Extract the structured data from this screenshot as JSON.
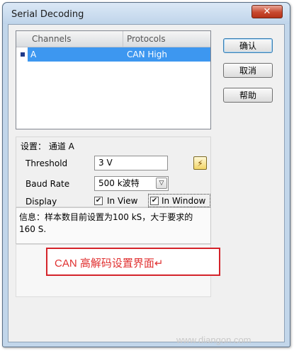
{
  "window": {
    "title": "Serial Decoding",
    "close_symbol": "✕"
  },
  "table": {
    "columns": [
      "Channels",
      "Protocols"
    ],
    "rows": [
      {
        "channel": "A",
        "protocol": "CAN High"
      }
    ]
  },
  "buttons": {
    "ok": "确认",
    "cancel": "取消",
    "help": "帮助"
  },
  "settings": {
    "heading": "设置： 通道 A",
    "threshold_label": "Threshold",
    "threshold_value": "3 V",
    "baud_label": "Baud Rate",
    "baud_value": "500 k波特",
    "display_label": "Display",
    "in_view_label": "In View",
    "in_view_checked": true,
    "in_window_label": "In Window",
    "in_window_checked": true
  },
  "info": {
    "message": "信息：样本数目前设置为100 kS，大于要求的160 S."
  },
  "caption": {
    "text": "CAN 高解码设置界面↵"
  },
  "watermark": {
    "text": "www.diangon.com"
  },
  "icons": {
    "check": "✔",
    "dropdown": "▽",
    "wand": "⚡"
  }
}
